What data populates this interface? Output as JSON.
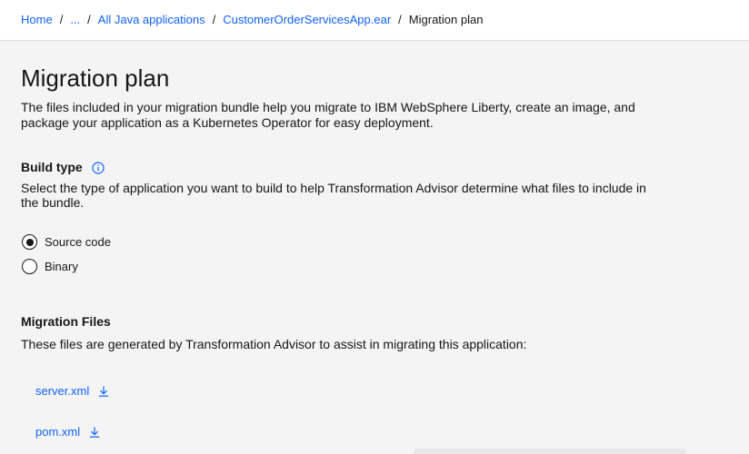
{
  "breadcrumb": {
    "items": [
      "Home",
      "...",
      "All Java applications",
      "CustomerOrderServicesApp.ear"
    ],
    "current": "Migration plan",
    "separator": "/"
  },
  "page": {
    "title": "Migration plan",
    "intro_line1": "The files included in your migration bundle help you migrate to IBM WebSphere Liberty, create an image, and",
    "intro_line2": "package your application as a Kubernetes Operator for easy deployment."
  },
  "build_type": {
    "heading": "Build type",
    "info_icon": "information-icon",
    "desc_line1": "Select the type of application you want to build to help Transformation Advisor determine what files to include in",
    "desc_line2": "the bundle.",
    "options": [
      {
        "label": "Source code",
        "selected": true
      },
      {
        "label": "Binary",
        "selected": false
      }
    ]
  },
  "migration_files": {
    "heading": "Migration Files",
    "desc": "These files are generated by Transformation Advisor to assist in migrating this application:",
    "files": [
      {
        "name": "server.xml",
        "icon": "download-icon"
      },
      {
        "name": "pom.xml",
        "icon": "download-icon"
      }
    ]
  },
  "colors": {
    "link": "#0f62fe",
    "background": "#f4f4f4",
    "text": "#161616"
  }
}
